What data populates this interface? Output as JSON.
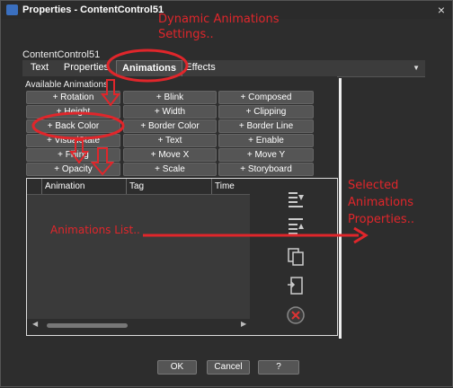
{
  "window": {
    "title": "Properties - ContentControl51"
  },
  "annotations": {
    "dynamic_line1": "Dynamic Animations",
    "dynamic_line2": "Settings..",
    "list": "Animations List..",
    "selected_line1": "Selected",
    "selected_line2": "Animations",
    "selected_line3": "Properties.."
  },
  "control_name": "ContentControl51",
  "tabs": [
    {
      "label": "Text"
    },
    {
      "label": "Properties"
    },
    {
      "label": "Animations",
      "active": true
    },
    {
      "label": "Effects"
    }
  ],
  "available_label": "Available Animations",
  "animation_buttons": [
    "+ Rotation",
    "+ Blink",
    "+ Composed Movement",
    "+ Height",
    "+ Width",
    "+ Clipping",
    "+ Back Color",
    "+ Border Color",
    "+ Border Line",
    "+ VisualState",
    "+ Text",
    "+ Enable",
    "+ Filling",
    "+ Move X",
    "+ Move Y",
    "+ Opacity",
    "+ Scale",
    "+ Storyboard"
  ],
  "list_columns": [
    "Animation",
    "Tag",
    "Time"
  ],
  "tools": [
    {
      "icon": "move-down-icon"
    },
    {
      "icon": "move-up-icon"
    },
    {
      "icon": "copy-icon"
    },
    {
      "icon": "paste-icon"
    },
    {
      "icon": "delete-icon"
    }
  ],
  "footer": {
    "ok": "OK",
    "cancel": "Cancel",
    "help": "?"
  },
  "colors": {
    "annotation": "#e0262b",
    "button": "#555555",
    "background": "#2d2d2d"
  }
}
